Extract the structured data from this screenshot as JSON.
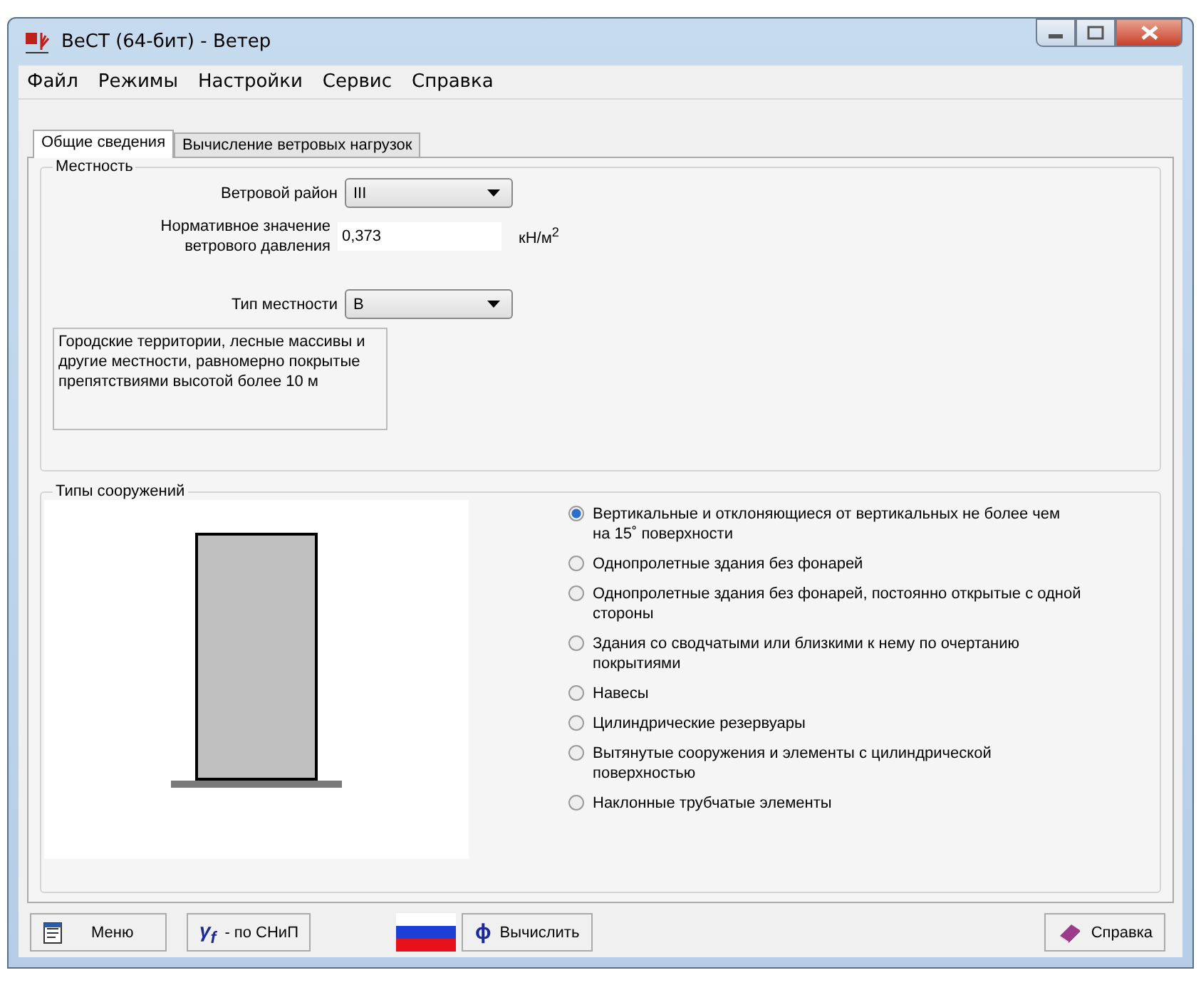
{
  "window": {
    "title": "ВеСТ (64-бит) - Ветер"
  },
  "menu": [
    "Файл",
    "Режимы",
    "Настройки",
    "Сервис",
    "Справка"
  ],
  "tabs": [
    {
      "label": "Общие сведения",
      "selected": true
    },
    {
      "label": "Вычисление ветровых нагрузок",
      "selected": false
    }
  ],
  "terrain": {
    "title": "Местность",
    "wind_region": {
      "label": "Ветровой район",
      "value": "III"
    },
    "pressure": {
      "label": "Нормативное значение ветрового давления",
      "value": "0,373",
      "unit": "кН/м$^{2}$"
    },
    "terrain_type": {
      "label": "Тип местности",
      "value": "B"
    },
    "description": "Городские территории, лесные массивы и другие местности, равномерно покрытые препятствиями высотой более 10 м"
  },
  "structures": {
    "title": "Типы сооружений",
    "options": [
      {
        "label": "Вертикальные и отклоняющиеся от вертикальных не более чем на 15˚ поверхности",
        "selected": true
      },
      {
        "label": "Однопролетные здания без фонарей",
        "selected": false
      },
      {
        "label": "Однопролетные здания без фонарей, постоянно открытые с одной стороны",
        "selected": false
      },
      {
        "label": "Здания со сводчатыми или близкими к нему по очертанию покрытиями",
        "selected": false
      },
      {
        "label": "Навесы",
        "selected": false
      },
      {
        "label": "Цилиндрические резервуары",
        "selected": false
      },
      {
        "label": "Вытянутые сооружения и элементы с цилиндрической поверхностью",
        "selected": false
      },
      {
        "label": "Наклонные трубчатые элементы",
        "selected": false
      }
    ]
  },
  "buttons": {
    "menu": "Меню",
    "factor_symbol": "γ$_{f}$",
    "factor": "- по СНиП",
    "calc_symbol": "ɸ",
    "calc": "Вычислить",
    "help": "Справка"
  }
}
